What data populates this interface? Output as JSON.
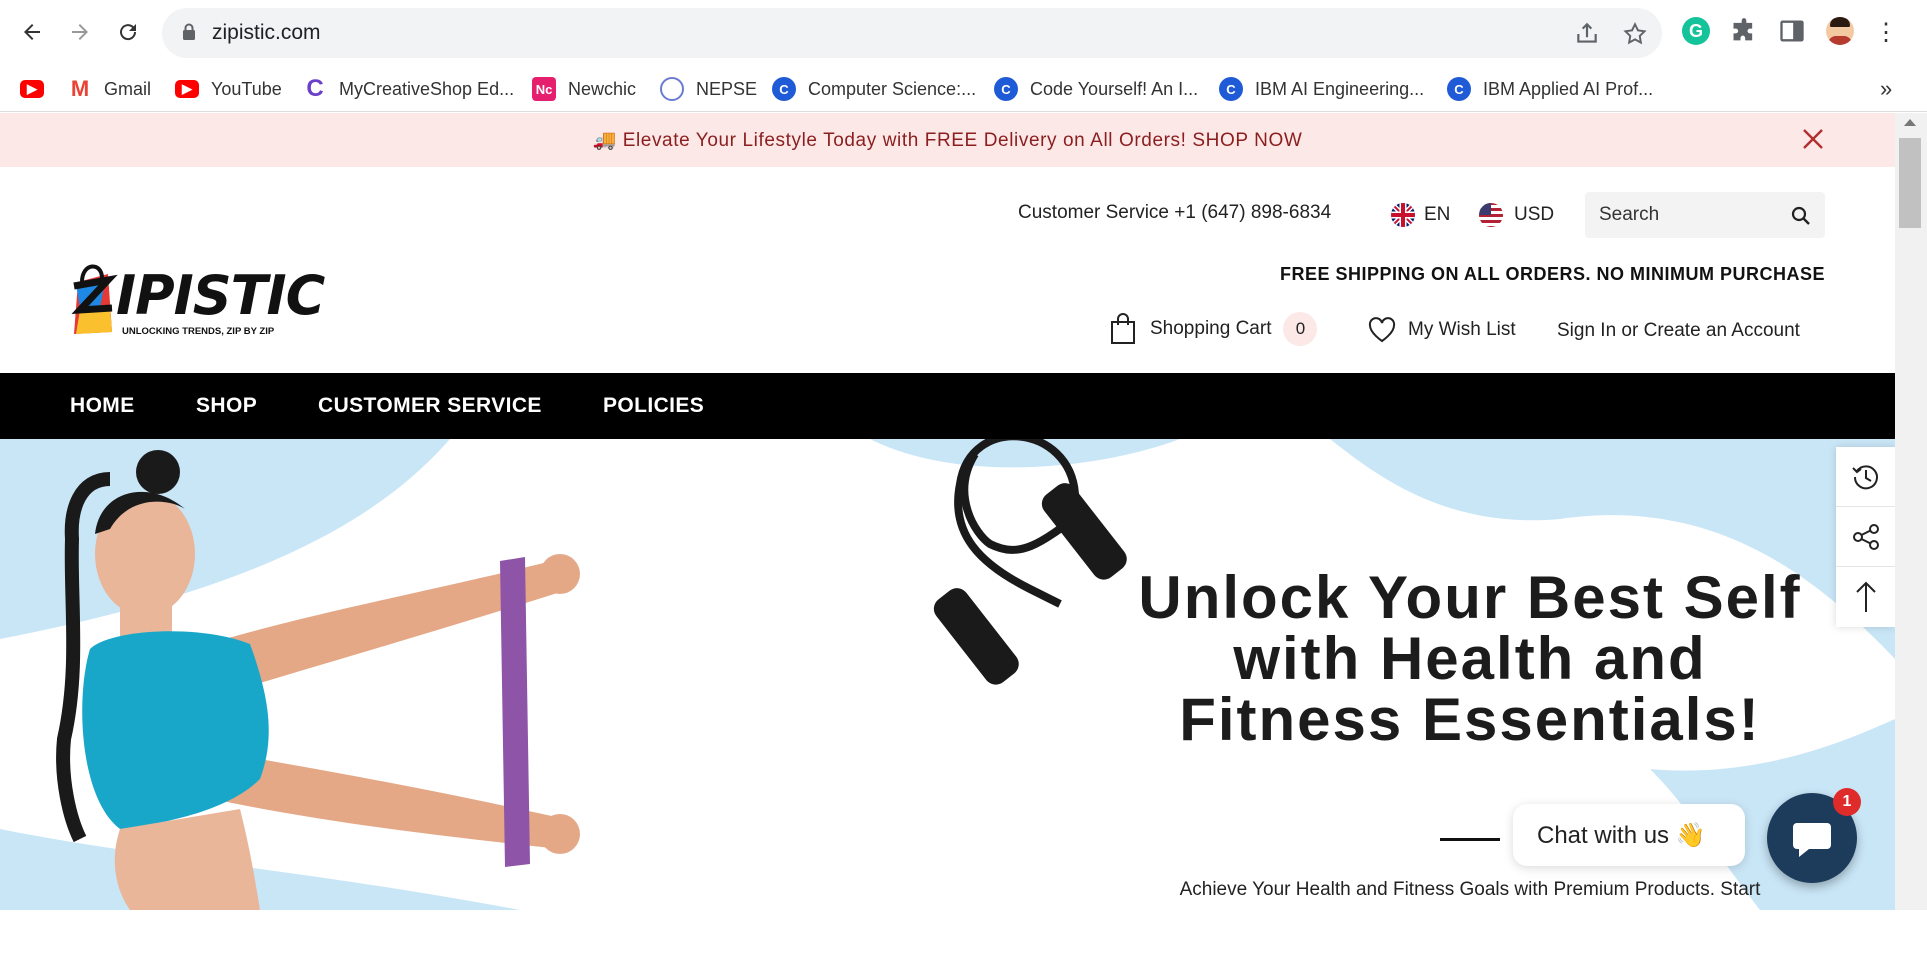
{
  "browser": {
    "url": "zipistic.com",
    "bookmarks": [
      {
        "label": ""
      },
      {
        "label": "Gmail"
      },
      {
        "label": "YouTube"
      },
      {
        "label": "MyCreativeShop Ed..."
      },
      {
        "label": "Newchic"
      },
      {
        "label": "NEPSE"
      },
      {
        "label": "Computer Science:..."
      },
      {
        "label": "Code Yourself! An I..."
      },
      {
        "label": "IBM AI Engineering..."
      },
      {
        "label": "IBM Applied AI Prof..."
      }
    ],
    "more_label": "»"
  },
  "announcement": {
    "text": "🚚 Elevate Your Lifestyle Today with FREE Delivery on All Orders! SHOP NOW"
  },
  "header": {
    "logo_text": "IPISTIC",
    "logo_tagline": "UNLOCKING TRENDS, ZIP BY ZIP",
    "customer_service": "Customer Service +1 (647) 898-6834",
    "language": "EN",
    "currency": "USD",
    "search_placeholder": "Search",
    "free_shipping": "FREE SHIPPING ON ALL ORDERS. NO MINIMUM PURCHASE",
    "cart_label": "Shopping Cart",
    "cart_count": "0",
    "wishlist_label": "My Wish List",
    "signin_label": "Sign In or Create an Account"
  },
  "menu": {
    "items": [
      {
        "label": "HOME"
      },
      {
        "label": "SHOP"
      },
      {
        "label": "CUSTOMER SERVICE"
      },
      {
        "label": "POLICIES"
      }
    ]
  },
  "hero": {
    "title": "Unlock Your Best Self with Health and Fitness Essentials!",
    "subtitle": "Achieve Your Health and Fitness Goals with Premium Products. Start"
  },
  "chat": {
    "label": "Chat with us 👋",
    "badge": "1"
  },
  "colors": {
    "announcement_bg": "#fde8e8",
    "announcement_text": "#8b1e1e",
    "menu_bg": "#000000",
    "hero_accent": "#c9e6f7",
    "chat_button": "#1d3c5c"
  }
}
